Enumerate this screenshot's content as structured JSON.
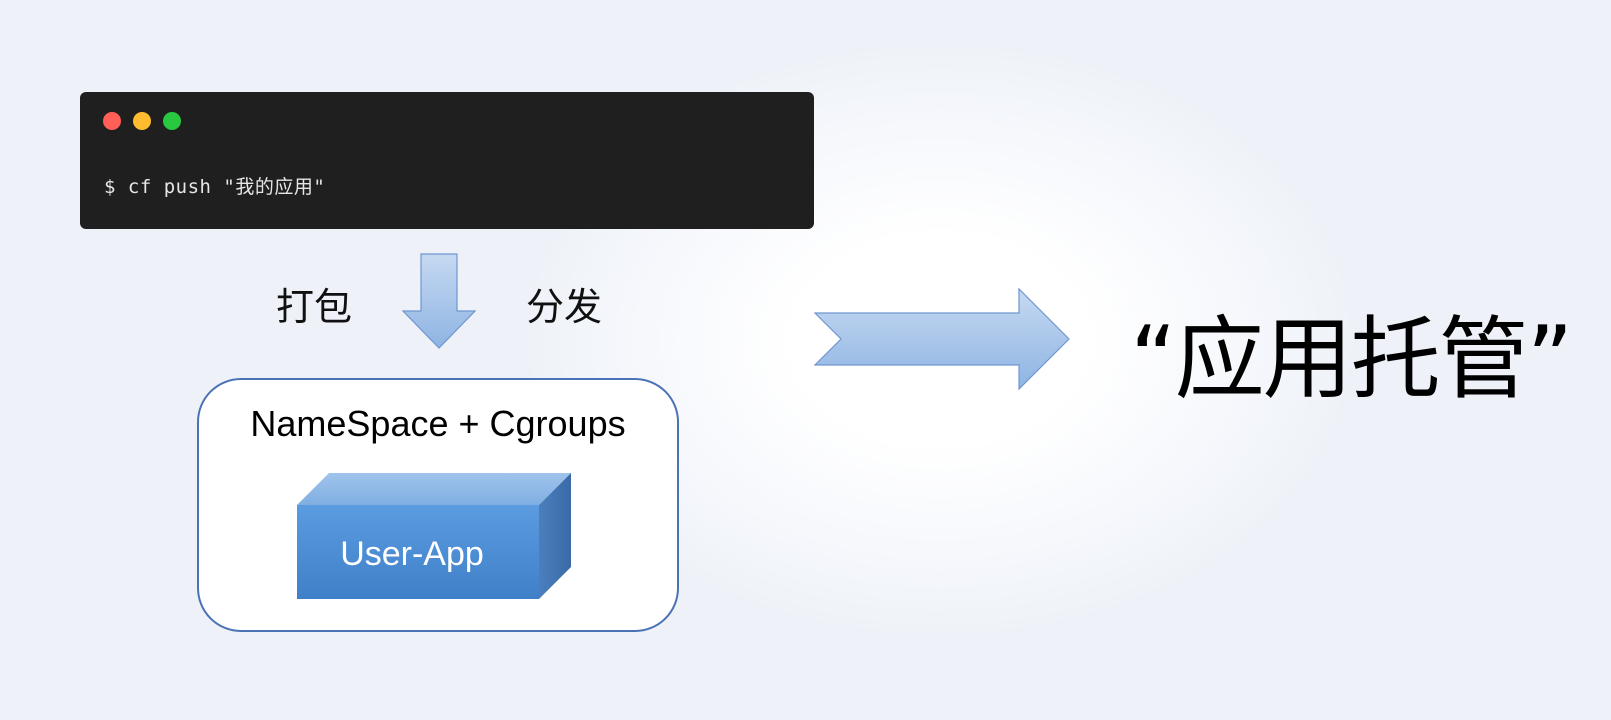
{
  "terminal": {
    "command": "$ cf push \"我的应用\"",
    "dots": [
      {
        "name": "close",
        "color": "#ff5f57"
      },
      {
        "name": "minimize",
        "color": "#febc2e"
      },
      {
        "name": "maximize",
        "color": "#28c840"
      }
    ]
  },
  "flow": {
    "pack_label": "打包",
    "distribute_label": "分发"
  },
  "container": {
    "title": "NameSpace + Cgroups",
    "app_label": "User-App"
  },
  "result": {
    "title": "“应用托管”"
  },
  "colors": {
    "arrow_fill_light": "#c6d9f1",
    "arrow_fill_dark": "#8eb4e3",
    "arrow_stroke": "#6f96d0",
    "box_border": "#4a72b5",
    "cube_front": "#4f8fd6",
    "cube_top": "#8bb6e6",
    "cube_side": "#3f72b0"
  }
}
